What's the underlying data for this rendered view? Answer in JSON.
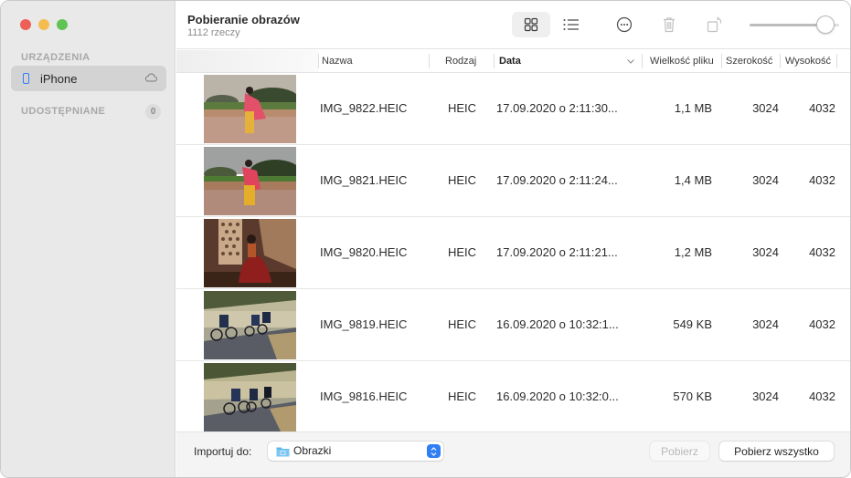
{
  "window": {
    "traffic_lights": [
      "close",
      "minimize",
      "zoom"
    ]
  },
  "sidebar": {
    "devices_section": "URZĄDZENIA",
    "device": {
      "label": "iPhone",
      "icon": "iphone-icon",
      "status_icon": "cloud-icon"
    },
    "shared_section": "UDOSTĘPNIANE",
    "shared_count": "0"
  },
  "toolbar": {
    "title": "Pobieranie obrazów",
    "subtitle": "1112 rzeczy",
    "view_mode": "grid",
    "buttons": [
      "grid-view",
      "list-view",
      "more-options",
      "delete",
      "rotate"
    ],
    "thumbnail_size_fraction": 0.85
  },
  "table": {
    "columns": [
      "Nazwa",
      "Rodzaj",
      "Data",
      "Wielkość pliku",
      "Szerokość",
      "Wysokość"
    ],
    "sorted_column": "Data",
    "rows": [
      {
        "name": "IMG_9822.HEIC",
        "kind": "HEIC",
        "date": "17.09.2020 o 2:11:30...",
        "size": "1,1 MB",
        "width": "3024",
        "height": "4032",
        "thumb": "woman-sari-garden"
      },
      {
        "name": "IMG_9821.HEIC",
        "kind": "HEIC",
        "date": "17.09.2020 o 2:11:24...",
        "size": "1,4 MB",
        "width": "3024",
        "height": "4032",
        "thumb": "woman-sari-garden"
      },
      {
        "name": "IMG_9820.HEIC",
        "kind": "HEIC",
        "date": "17.09.2020 o 2:11:21...",
        "size": "1,2 MB",
        "width": "3024",
        "height": "4032",
        "thumb": "woman-lattice-window"
      },
      {
        "name": "IMG_9819.HEIC",
        "kind": "HEIC",
        "date": "16.09.2020 o 10:32:1...",
        "size": "549 KB",
        "width": "3024",
        "height": "4032",
        "thumb": "cyclists-road"
      },
      {
        "name": "IMG_9816.HEIC",
        "kind": "HEIC",
        "date": "16.09.2020 o 10:32:0...",
        "size": "570 KB",
        "width": "3024",
        "height": "4032",
        "thumb": "cyclists-road"
      }
    ]
  },
  "footer": {
    "import_label": "Importuj do:",
    "destination": "Obrazki",
    "import_button": "Pobierz",
    "import_all_button": "Pobierz wszystko"
  },
  "colors": {
    "accent": "#2f7ef6",
    "close": "#ee5f57",
    "minimize": "#f5bd4f",
    "zoom": "#5fc453"
  }
}
